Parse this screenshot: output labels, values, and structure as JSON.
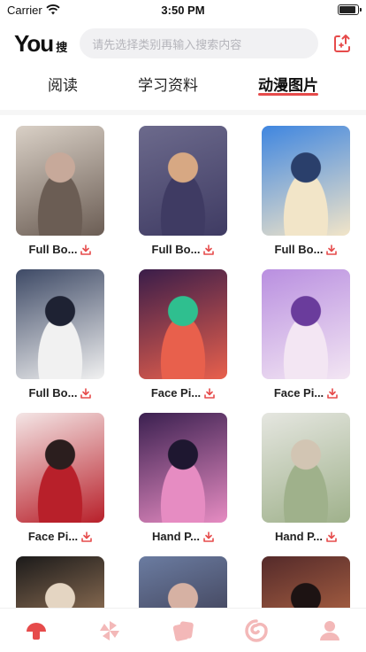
{
  "status": {
    "carrier": "Carrier",
    "time": "3:50 PM"
  },
  "header": {
    "logo_main": "You",
    "logo_sub": "搜",
    "search_placeholder": "请先选择类别再输入搜索内容"
  },
  "tabs": [
    {
      "label": "阅读",
      "active": false
    },
    {
      "label": "学习资料",
      "active": false
    },
    {
      "label": "动漫图片",
      "active": true
    }
  ],
  "colors": {
    "accent": "#e64b4b",
    "inactive_icon": "#f3b8b8"
  },
  "cards": [
    {
      "title": "Full Bo...",
      "palette": [
        "#d9d0c6",
        "#6b5d54",
        "#c7a99a"
      ]
    },
    {
      "title": "Full Bo...",
      "palette": [
        "#6c6a8c",
        "#3f3b63",
        "#d7a883"
      ]
    },
    {
      "title": "Full Bo...",
      "palette": [
        "#3f86e0",
        "#f2e5c8",
        "#2a3f6b"
      ]
    },
    {
      "title": "Full Bo...",
      "palette": [
        "#3e4a66",
        "#f1f1f1",
        "#1e2233"
      ]
    },
    {
      "title": "Face Pi...",
      "palette": [
        "#3a1d4a",
        "#e8604c",
        "#2fbf8f"
      ]
    },
    {
      "title": "Face Pi...",
      "palette": [
        "#b98fe0",
        "#f3e6f3",
        "#6a3c9c"
      ]
    },
    {
      "title": "Face Pi...",
      "palette": [
        "#f4e6e6",
        "#b8202a",
        "#2b1e1e"
      ]
    },
    {
      "title": "Hand P...",
      "palette": [
        "#3b2050",
        "#e68cc2",
        "#1e1730"
      ]
    },
    {
      "title": "Hand P...",
      "palette": [
        "#e5e6e0",
        "#9fb18b",
        "#d2c5b3"
      ]
    },
    {
      "title": "",
      "palette": [
        "#1b1a1a",
        "#c99b72",
        "#e4d5c2"
      ]
    },
    {
      "title": "",
      "palette": [
        "#6b7ca1",
        "#2f2a3b",
        "#d6b1a3"
      ]
    },
    {
      "title": "",
      "palette": [
        "#542a2a",
        "#d27b4e",
        "#1d1313"
      ]
    }
  ],
  "bottom_nav": [
    {
      "name": "mushroom-icon",
      "active": true
    },
    {
      "name": "pinwheel-icon",
      "active": false
    },
    {
      "name": "cards-icon",
      "active": false
    },
    {
      "name": "swirl-icon",
      "active": false
    },
    {
      "name": "profile-icon",
      "active": false
    }
  ]
}
